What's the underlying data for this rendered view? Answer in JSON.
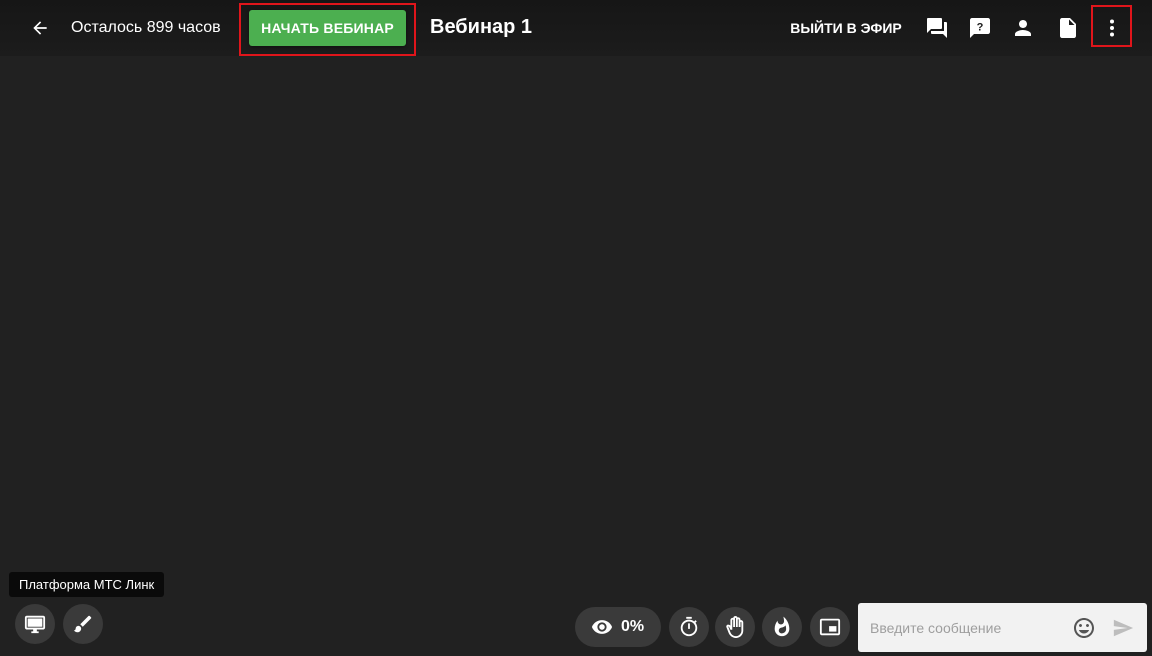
{
  "header": {
    "time_left": "Осталось 899 часов",
    "start_button_label": "НАЧАТЬ ВЕБИНАР",
    "title": "Вебинар 1",
    "go_live_label": "ВЫЙТИ В ЭФИР",
    "icons": [
      "back-arrow-icon",
      "chat-icon",
      "question-icon",
      "person-icon",
      "document-icon",
      "more-vertical-icon"
    ]
  },
  "footer": {
    "tooltip": "Платформа МТС Линк",
    "left_icons": [
      "monitor-icon",
      "brush-icon"
    ],
    "viewers_percent": "0%",
    "action_icons": [
      "eye-icon",
      "timer-icon",
      "hand-icon",
      "fire-icon",
      "picture-in-picture-icon"
    ],
    "chat_placeholder": "Введите сообщение",
    "chat_icons": [
      "emoji-icon",
      "send-icon"
    ]
  },
  "colors": {
    "background": "#212121",
    "topbar": "#1a1a1a",
    "accent_green": "#4caf50",
    "highlight_red": "#e0151b",
    "button_dark": "#3a3a3a",
    "chat_bg": "#f2f2f2"
  }
}
